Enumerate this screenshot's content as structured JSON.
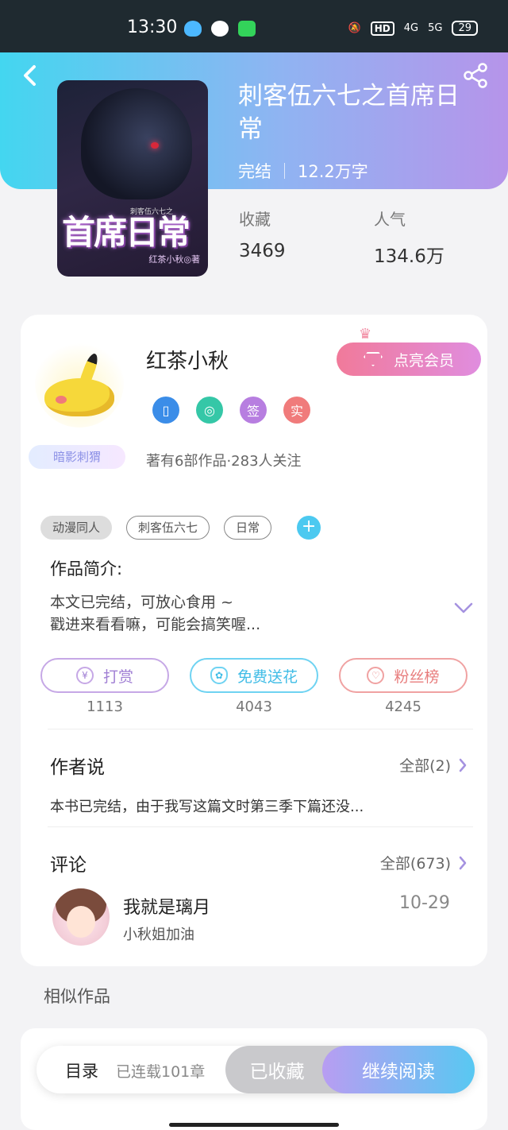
{
  "status_bar": {
    "time": "13:30",
    "network_hd": "HD",
    "signal_4g": "4G",
    "signal_5g": "5G",
    "battery": "29"
  },
  "book": {
    "title": "刺客伍六七之首席日常",
    "status": "完结",
    "word_count": "12.2万字",
    "cover": {
      "title": "首席日常",
      "subtitle": "刺客伍六七之",
      "author": "红茶小秋◎著"
    }
  },
  "stats": [
    {
      "label": "收藏",
      "value": "3469"
    },
    {
      "label": "人气",
      "value": "134.6万"
    }
  ],
  "author": {
    "name": "红茶小秋",
    "badge_title": "暗影刺猬",
    "vip_button": "点亮会员",
    "icons": [
      {
        "name": "phone-badge-icon",
        "glyph": "▯",
        "color": "#3b8de8"
      },
      {
        "name": "candy-badge-icon",
        "glyph": "◎",
        "color": "#35c7a7"
      },
      {
        "name": "sign-badge-icon",
        "glyph": "签",
        "color": "#b77ee0"
      },
      {
        "name": "real-badge-icon",
        "glyph": "实",
        "color": "#f07b7b"
      }
    ],
    "stats_text": "著有6部作品·283人关注"
  },
  "tags": [
    "动漫同人",
    "刺客伍六七",
    "日常"
  ],
  "intro": {
    "heading": "作品简介:",
    "line1": "本文已完结，可放心食用 ~",
    "line2": "戳进来看看嘛，可能会搞笑喔..."
  },
  "actions": [
    {
      "label": "打赏",
      "count": "1113",
      "color": "#b08ad8",
      "icon": "¥"
    },
    {
      "label": "免费送花",
      "count": "4043",
      "color": "#4cc9f0",
      "icon": "✿"
    },
    {
      "label": "粉丝榜",
      "count": "4245",
      "color": "#ef8a8a",
      "icon": "♡"
    }
  ],
  "author_say": {
    "heading": "作者说",
    "more": "全部(2)",
    "text": "本书已完结，由于我写这篇文时第三季下篇还没..."
  },
  "comments": {
    "heading": "评论",
    "more": "全部(673)",
    "items": [
      {
        "user": "我就是璃月",
        "date": "10-29",
        "text": "小秋姐加油"
      }
    ]
  },
  "similar": {
    "heading": "相似作品"
  },
  "bottom_bar": {
    "toc": "目录",
    "chapters": "已连载101章",
    "favorited": "已收藏",
    "continue": "继续阅读"
  }
}
